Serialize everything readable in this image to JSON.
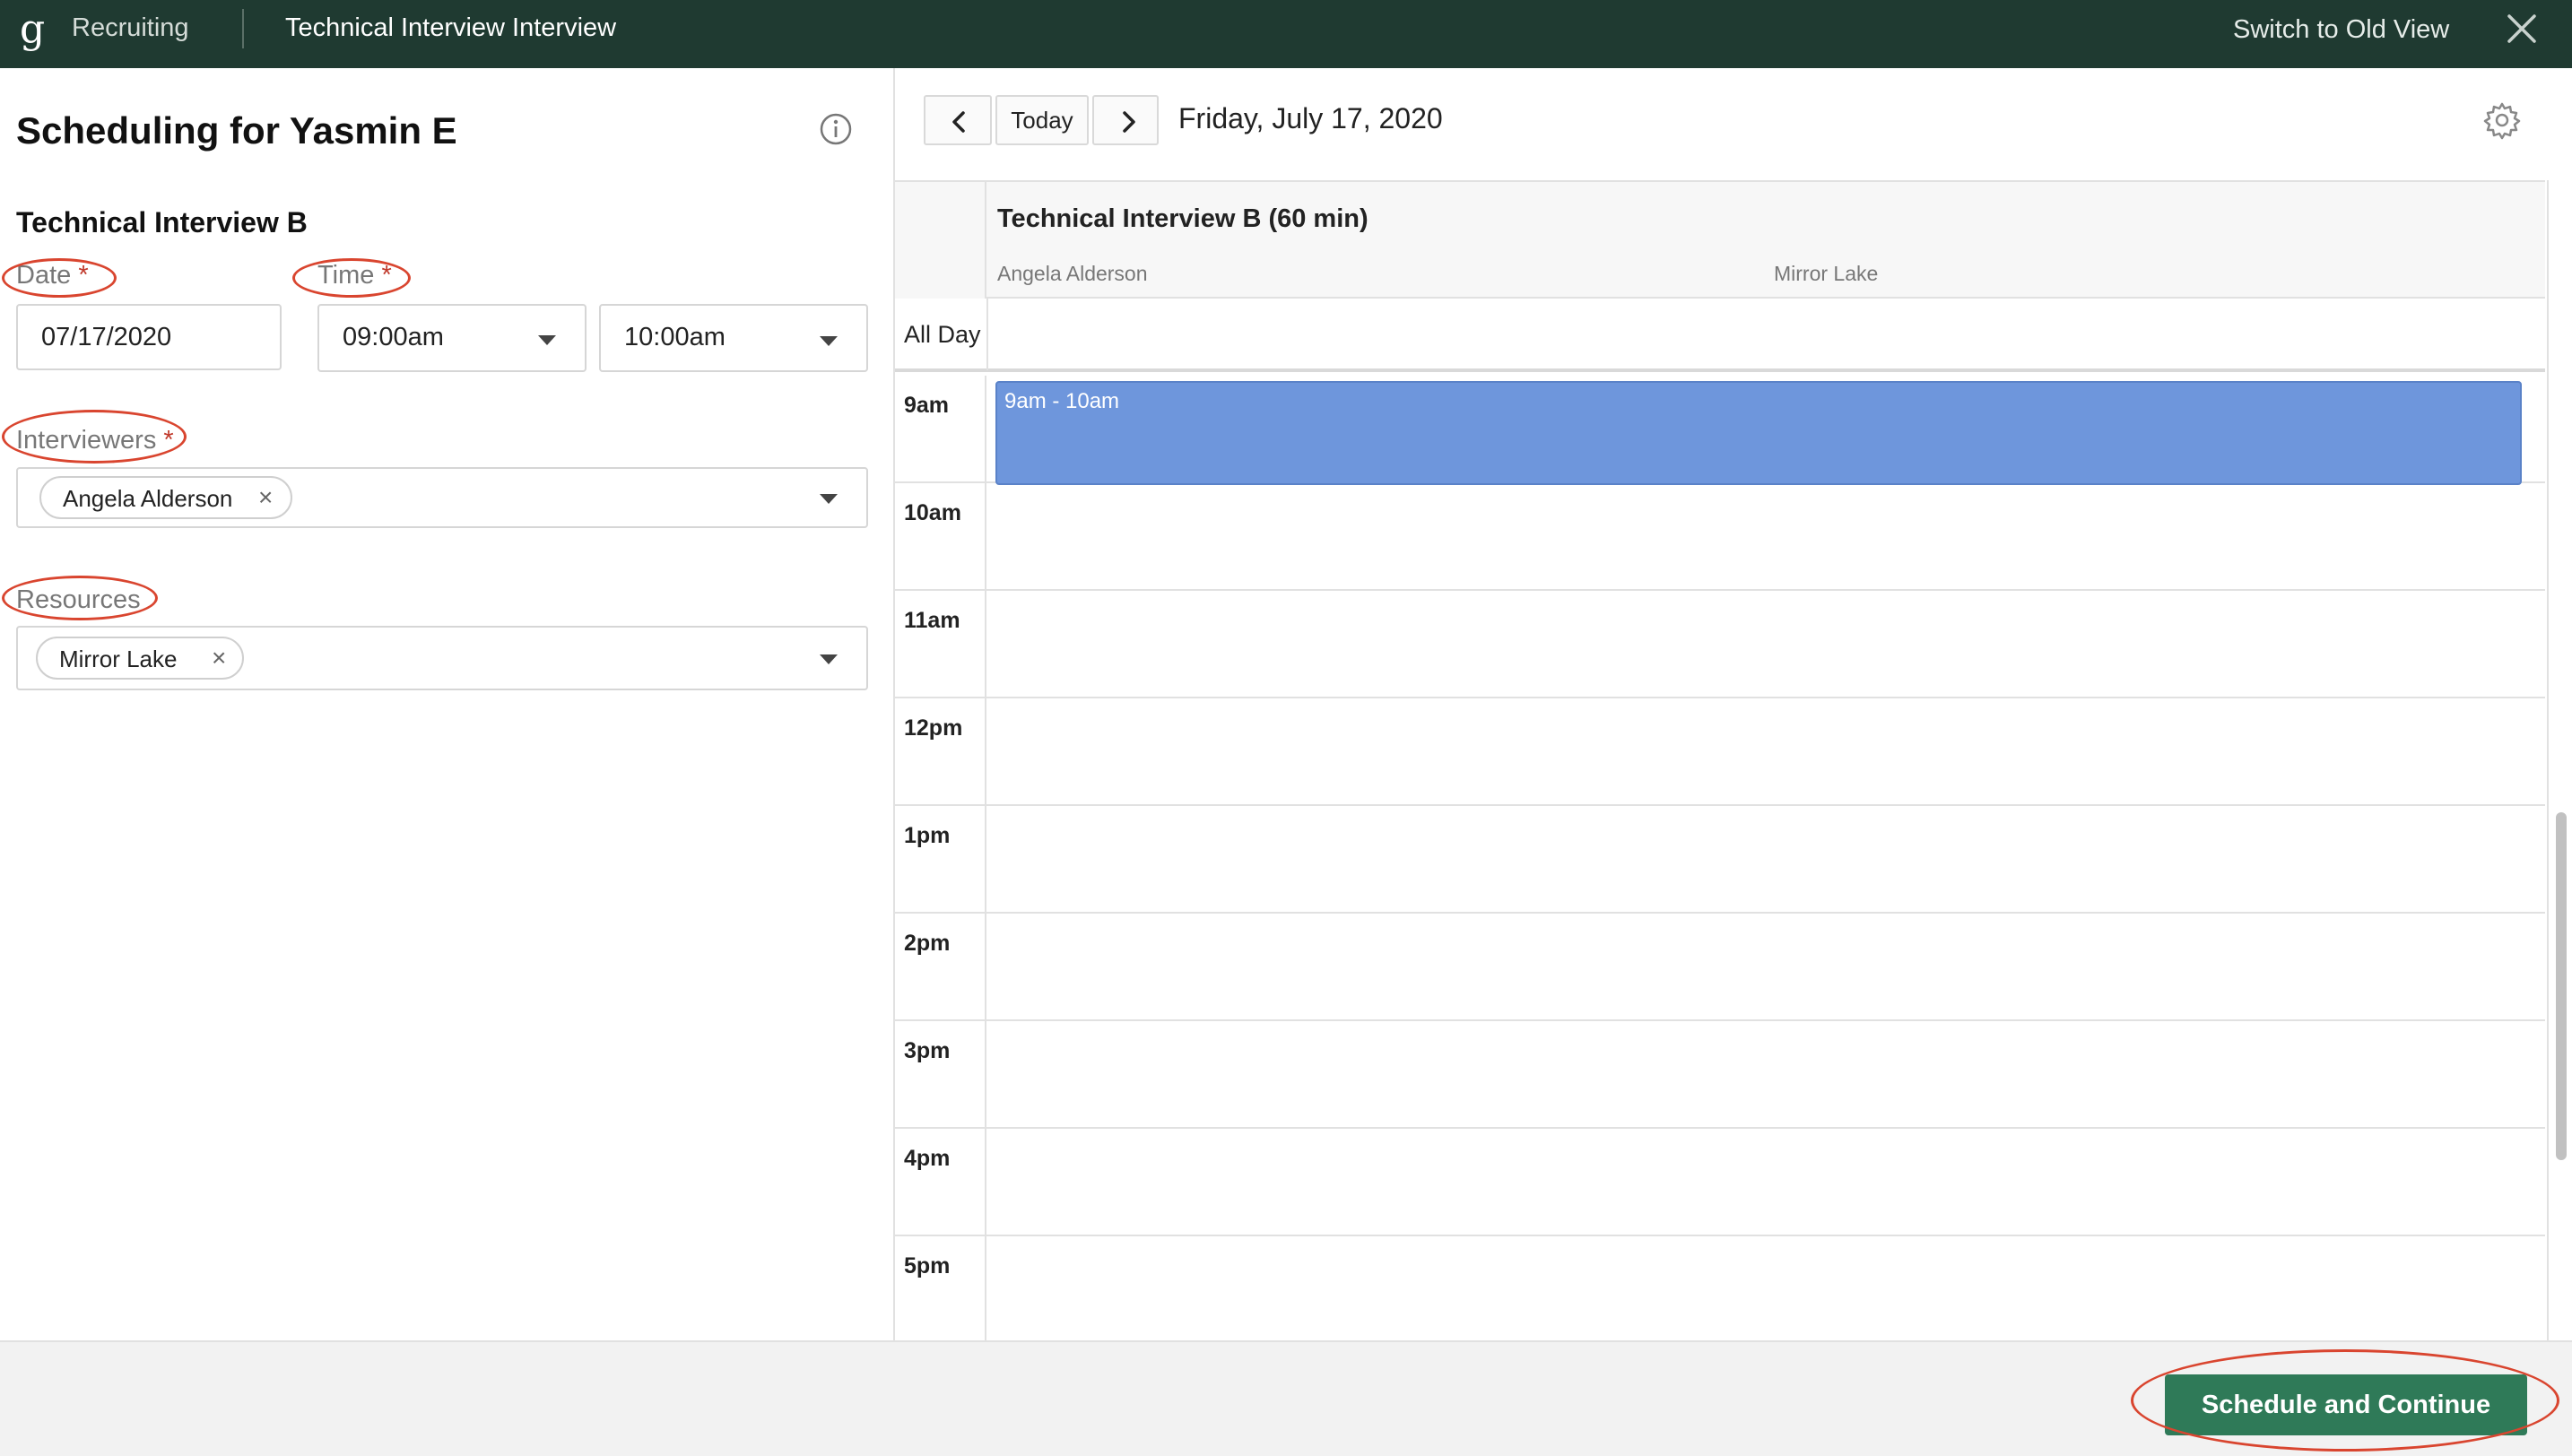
{
  "topbar": {
    "logo": "g",
    "app_name": "Recruiting",
    "page_title": "Technical Interview Interview",
    "switch_view_label": "Switch to Old View",
    "close_icon": "close-icon"
  },
  "form": {
    "title": "Scheduling for Yasmin E",
    "info_icon": "info-icon",
    "section_title": "Technical Interview B",
    "date": {
      "label": "Date",
      "required_mark": "*",
      "value": "07/17/2020"
    },
    "time": {
      "label": "Time",
      "required_mark": "*",
      "start": "09:00am",
      "end": "10:00am"
    },
    "interviewers": {
      "label": "Interviewers",
      "required_mark": "*",
      "chips": [
        "Angela Alderson"
      ],
      "remove_glyph": "×"
    },
    "resources": {
      "label": "Resources",
      "chips": [
        "Mirror Lake"
      ],
      "remove_glyph": "×"
    }
  },
  "calendar": {
    "prev_icon": "chevron-left-icon",
    "today_label": "Today",
    "next_icon": "chevron-right-icon",
    "date_heading": "Friday, July 17, 2020",
    "settings_icon": "gear-icon",
    "column_title": "Technical Interview B (60 min)",
    "people": [
      "Angela Alderson",
      "Mirror Lake"
    ],
    "all_day_label": "All Day",
    "hours": [
      "9am",
      "10am",
      "11am",
      "12pm",
      "1pm",
      "2pm",
      "3pm",
      "4pm",
      "5pm"
    ],
    "event": {
      "label": "9am - 10am",
      "color": "#6e96dc"
    }
  },
  "footer": {
    "primary_label": "Schedule and Continue",
    "primary_color": "#2f7a58"
  },
  "colors": {
    "topbar": "#1f3a31",
    "highlight_ring": "#d9452f"
  }
}
